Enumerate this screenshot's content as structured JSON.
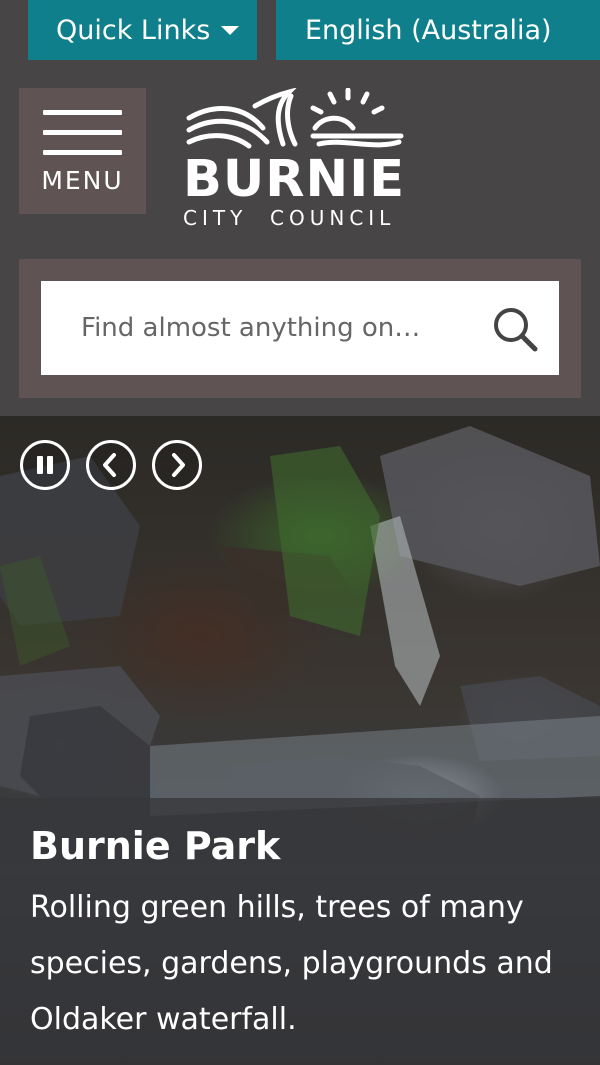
{
  "topbar": {
    "quick_links": "Quick Links",
    "language": "English (Australia)"
  },
  "menu": {
    "label": "MENU"
  },
  "logo": {
    "name": "BURNIE",
    "subtitle": "CITY  COUNCIL"
  },
  "search": {
    "placeholder": "Find almost anything on…",
    "icon": "search-icon"
  },
  "slider": {
    "controls": [
      "pause-icon",
      "chevron-left-icon",
      "chevron-right-icon"
    ],
    "slide": {
      "title": "Burnie Park",
      "description": "Rolling green hills, trees of many species, gardens, playgrounds and Oldaker waterfall."
    }
  },
  "colors": {
    "accent": "#0f7f8c",
    "background": "#474545",
    "panel": "#5f5453"
  }
}
